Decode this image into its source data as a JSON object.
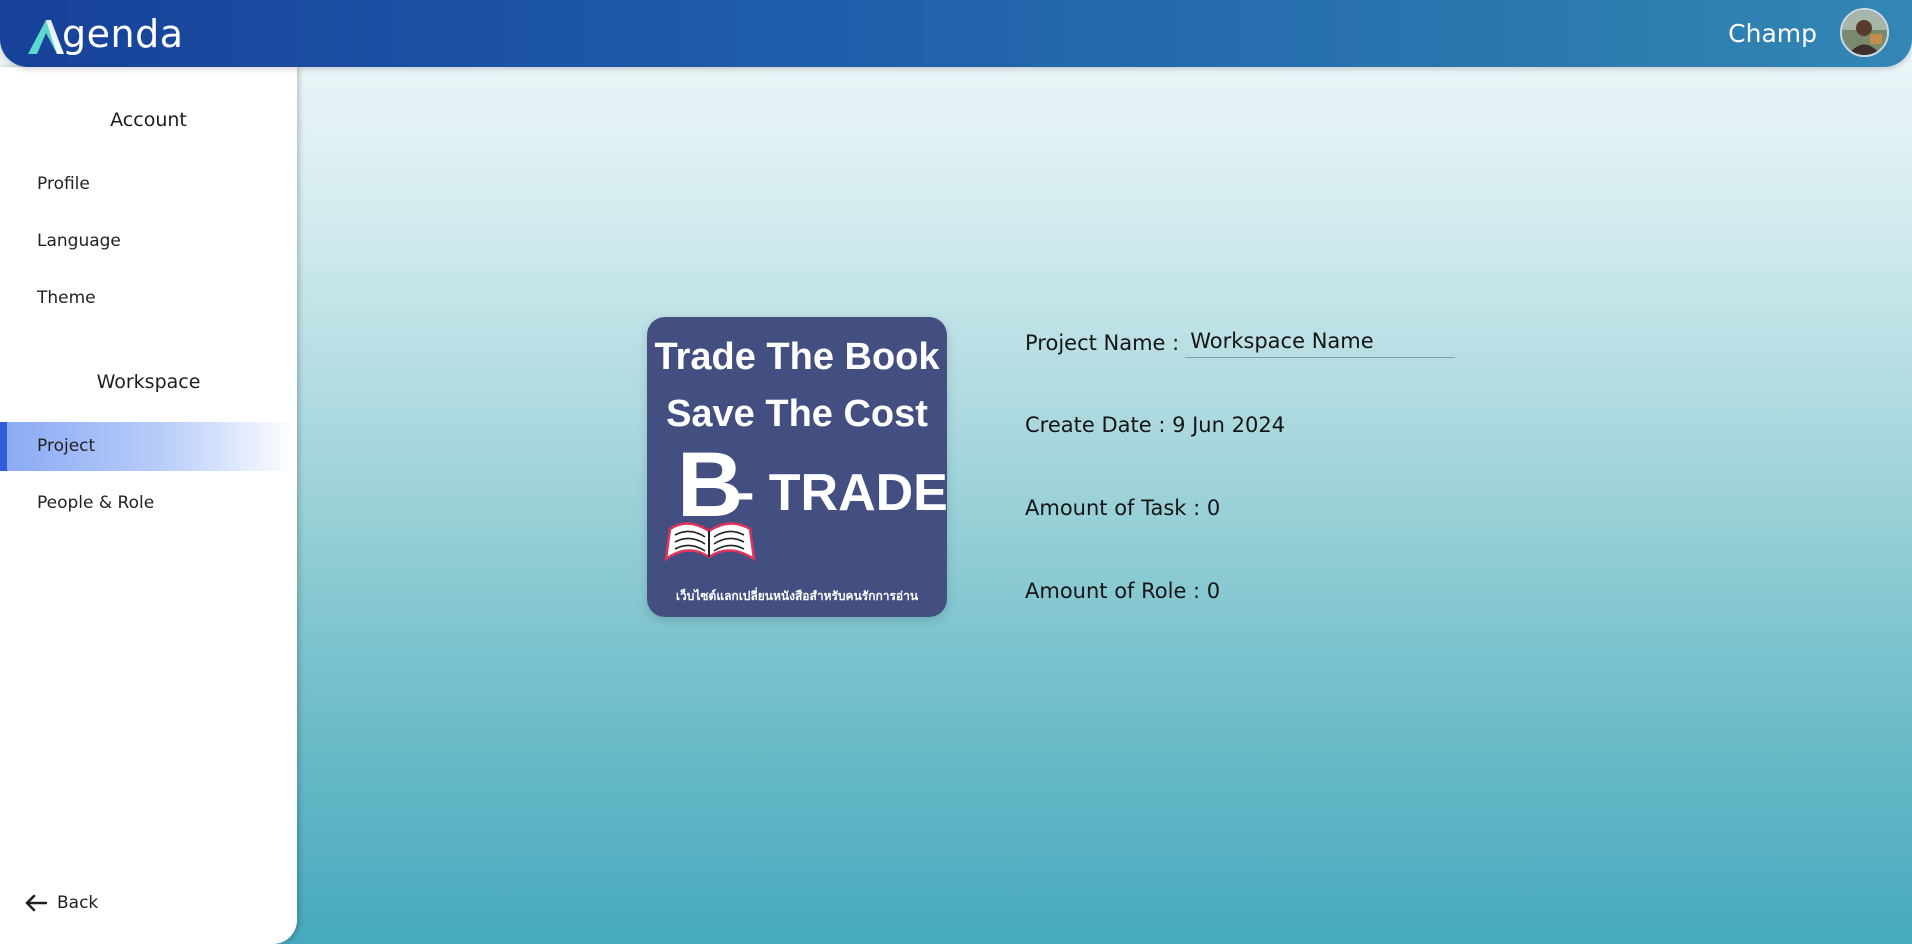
{
  "header": {
    "app_name": "genda",
    "user_name": "Champ"
  },
  "sidebar": {
    "account_title": "Account",
    "account_items": [
      {
        "label": "Profile"
      },
      {
        "label": "Language"
      },
      {
        "label": "Theme"
      }
    ],
    "workspace_title": "Workspace",
    "workspace_items": [
      {
        "label": "Project",
        "active": true
      },
      {
        "label": "People & Role",
        "active": false
      }
    ],
    "back_label": "Back"
  },
  "project": {
    "image": {
      "line1": "Trade The Book",
      "line2": "Save The Cost",
      "brand_letter": "B",
      "brand_rest": "- TRADE",
      "tagline": "เว็บไซต์แลกเปลี่ยนหนังสือสำหรับคนรักการอ่าน"
    },
    "name_label": "Project Name :",
    "name_value": "Workspace Name",
    "create_date": "Create Date : 9 Jun 2024",
    "task_count": "Amount of Task : 0",
    "role_count": "Amount of Role : 0"
  },
  "colors": {
    "header_start": "#17419a",
    "header_end": "#3387b4",
    "active_accent": "#2f5ed8",
    "logo_accent": "#5ed7d0",
    "image_bg": "#434f80"
  },
  "icons": {
    "logo": "agenda-logo-mark",
    "back": "arrow-left-icon",
    "avatar": "user-avatar"
  }
}
